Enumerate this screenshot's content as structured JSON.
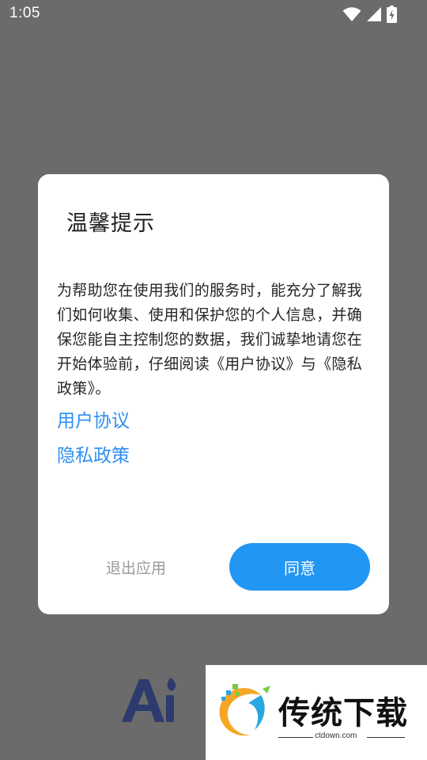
{
  "status_bar": {
    "time": "1:05",
    "icons": [
      "wifi-icon",
      "signal-icon",
      "battery-charging-icon"
    ]
  },
  "dialog": {
    "title": "温馨提示",
    "body": "为帮助您在使用我们的服务时，能充分了解我们如何收集、使用和保护您的个人信息，并确保您能自主控制您的数据，我们诚挚地请您在开始体验前，仔细阅读《用户协议》与《隐私政策》。",
    "links": [
      "用户协议",
      "隐私政策"
    ],
    "exit_label": "退出应用",
    "agree_label": "同意"
  },
  "watermark": {
    "text": "传统下载",
    "site": "ctdown.com"
  },
  "colors": {
    "backdrop": "#6b6b6b",
    "accent": "#2196f3",
    "link": "#2e8ff0",
    "logo": "#2c3a6e"
  }
}
